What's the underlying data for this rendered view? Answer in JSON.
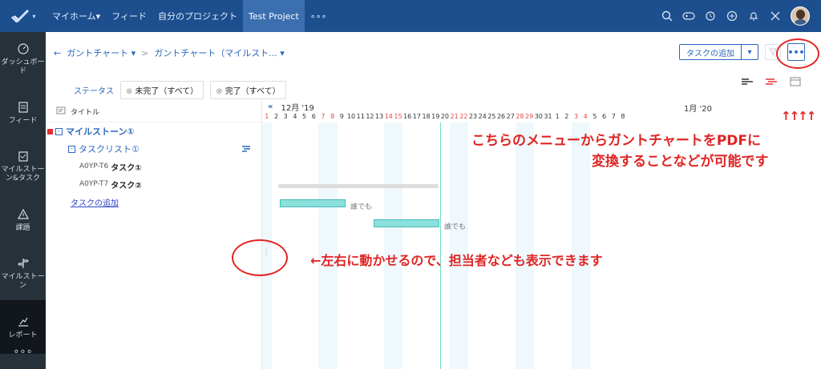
{
  "top_nav": {
    "items": [
      "マイホーム▾",
      "フィード",
      "自分のプロジェクト",
      "Test Project",
      "∘∘∘"
    ]
  },
  "sidebar": {
    "items": [
      {
        "label": "ダッシュボード",
        "icon": "dashboard-icon"
      },
      {
        "label": "フィード",
        "icon": "feed-icon"
      },
      {
        "label": "マイルストーン&タスク",
        "icon": "milestone-task-icon"
      },
      {
        "label": "課題",
        "icon": "warning-icon"
      },
      {
        "label": "マイルストーン",
        "icon": "signpost-icon"
      },
      {
        "label": "レポート",
        "icon": "report-icon"
      }
    ],
    "more": "∘∘∘"
  },
  "breadcrumb": {
    "back": "←",
    "first": "ガントチャート ▾",
    "sep": ">",
    "second": "ガントチャート（マイルスト... ▾"
  },
  "actions": {
    "add_task": "タスクの追加",
    "dropdown": "▾",
    "more": "•••"
  },
  "status_filter": {
    "label": "ステータス",
    "chips": [
      {
        "x": "⊗",
        "text": "未完了（すべて）"
      },
      {
        "x": "⊗",
        "text": "完了（すべて）"
      }
    ]
  },
  "list": {
    "header": "タイトル",
    "milestone": "マイルストーン①",
    "tasklist": "タスクリスト①",
    "tasks": [
      {
        "id": "A0YP-T6",
        "name": "タスク①"
      },
      {
        "id": "A0YP-T7",
        "name": "タスク②"
      }
    ],
    "add_task": "タスクの追加"
  },
  "gantt": {
    "nav": "«",
    "month": "12月 '19",
    "month2": "1月 '20",
    "days": [
      "1",
      "2",
      "3",
      "4",
      "5",
      "6",
      "7",
      "8",
      "9",
      "10",
      "11",
      "12",
      "13",
      "14",
      "15",
      "16",
      "17",
      "18",
      "19",
      "20",
      "21",
      "22",
      "23",
      "24",
      "25",
      "26",
      "27",
      "28",
      "29",
      "30",
      "31",
      "1",
      "2",
      "3",
      "4",
      "5",
      "6",
      "7",
      "8"
    ],
    "weekend_indices": [
      0,
      6,
      7,
      13,
      14,
      20,
      21,
      27,
      28,
      33,
      34
    ],
    "bar1_label": "誰でも",
    "bar2_label": "誰でも"
  },
  "annotations": {
    "line1": "こちらのメニューからガントチャートをPDFに",
    "line2": "変換することなどが可能です",
    "arrows": "↑↑↑↑",
    "side": "←左右に動かせるので、担当者なども表示できます"
  }
}
